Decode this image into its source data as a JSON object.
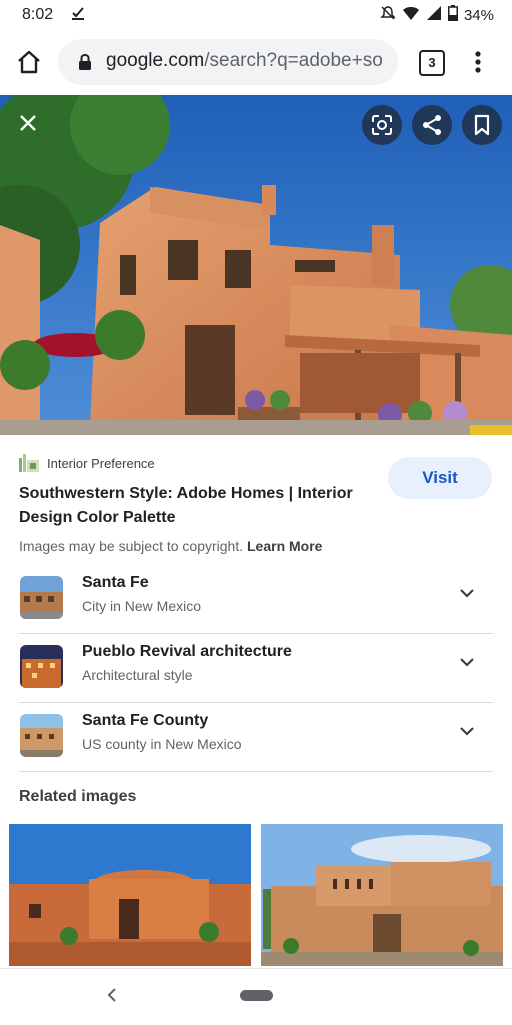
{
  "status_bar": {
    "time": "8:02",
    "download_icon": "download-done-icon",
    "battery": "34%"
  },
  "browser": {
    "url_host": "google.com",
    "url_path": "/search?q=adobe+so",
    "tab_count": "3"
  },
  "result": {
    "source_name": "Interior Preference",
    "title": "Southwestern Style: Adobe Homes | Interior Design Color Palette",
    "visit_label": "Visit",
    "copyright_text": "Images may be subject to copyright.",
    "learn_more": "Learn More"
  },
  "entities": [
    {
      "name": "Santa Fe",
      "subtitle": "City in New Mexico"
    },
    {
      "name": "Pueblo Revival architecture",
      "subtitle": "Architectural style"
    },
    {
      "name": "Santa Fe County",
      "subtitle": "US county in New Mexico"
    }
  ],
  "related_heading": "Related images",
  "colors": {
    "accent": "#1a56c5",
    "visit_bg": "#e8f0fe",
    "adobe": "#d88a5c",
    "sky": "#2b6fc4"
  }
}
